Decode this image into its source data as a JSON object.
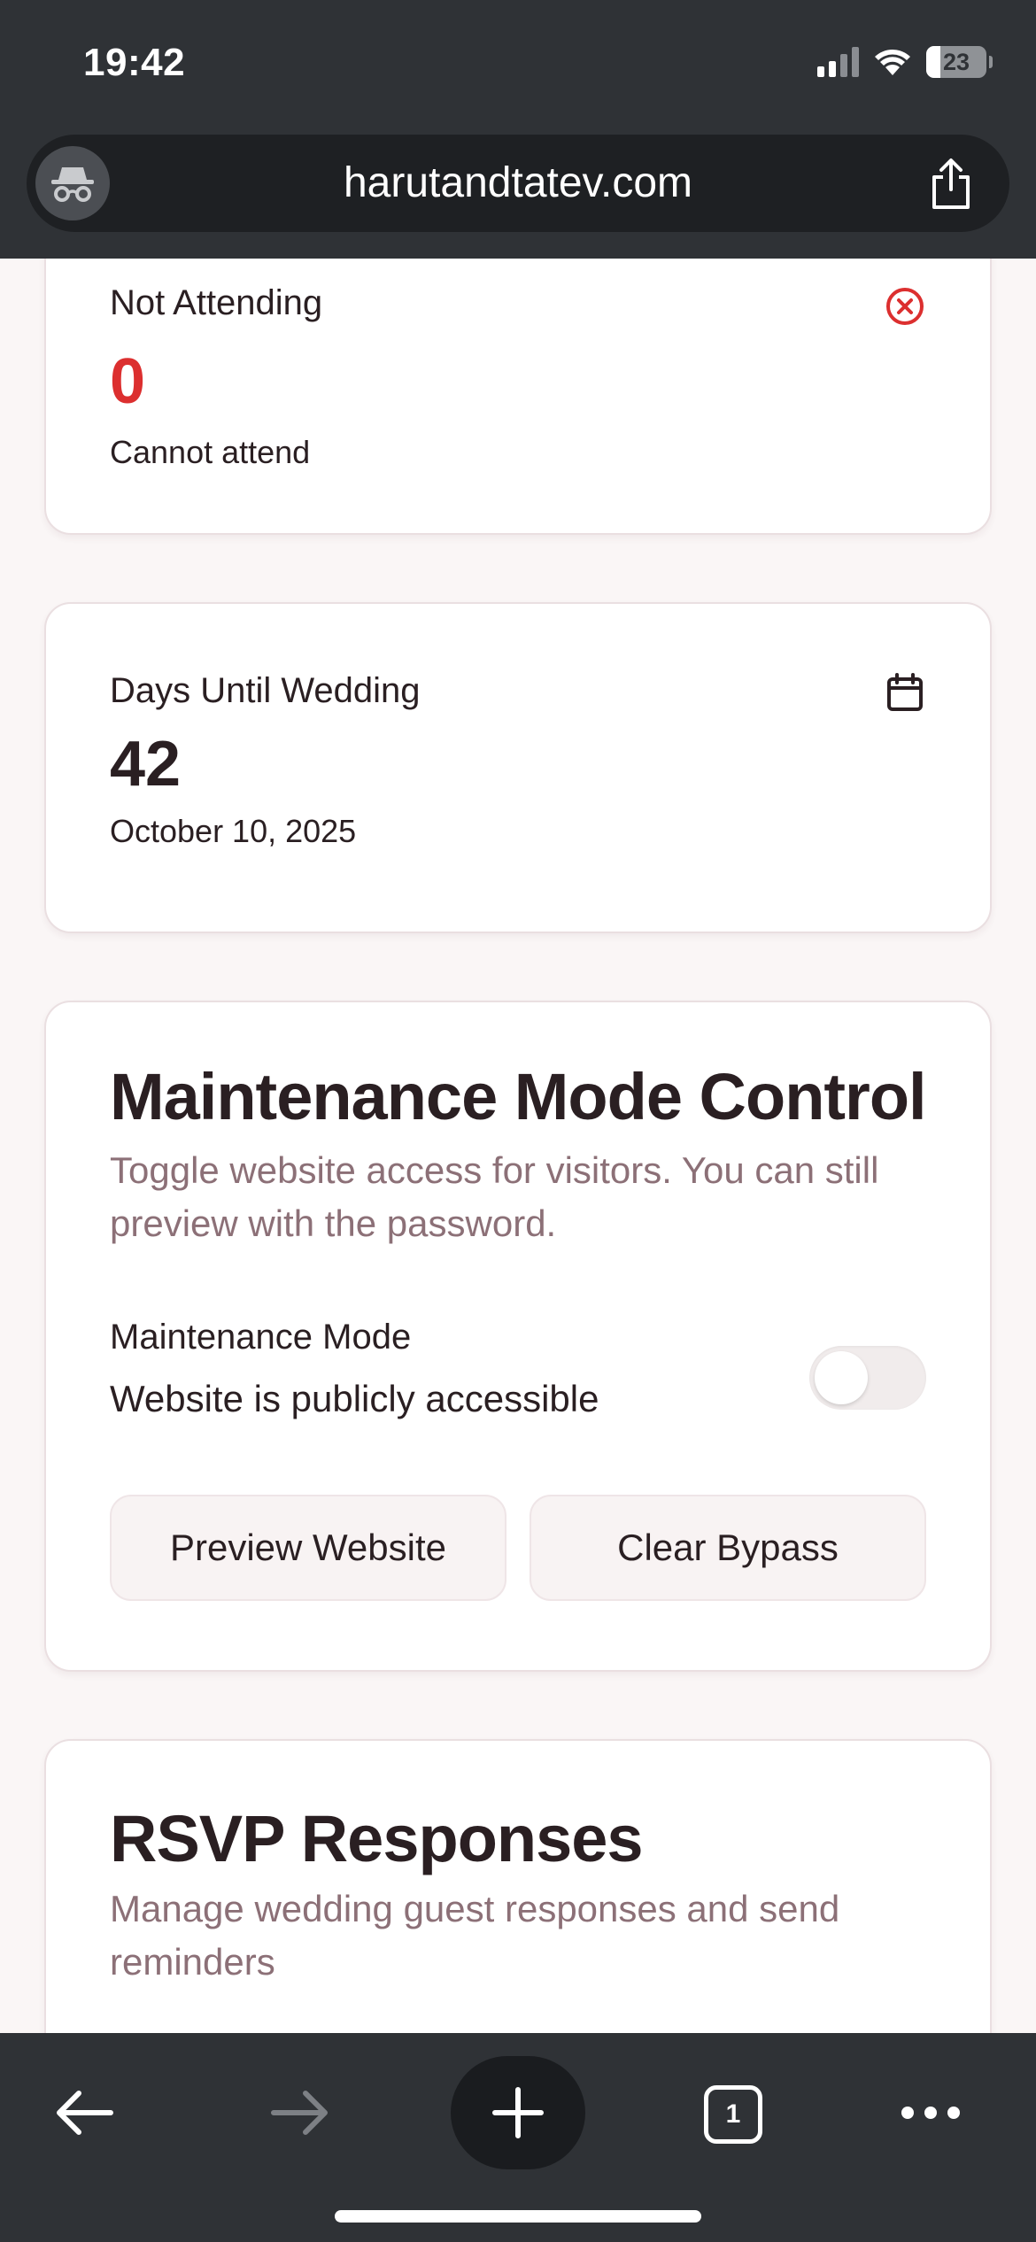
{
  "status_bar": {
    "time": "19:42",
    "battery": "23",
    "icons": [
      "cellular-signal-icon",
      "wifi-icon",
      "battery-icon"
    ]
  },
  "browser": {
    "url": "harutandtatev.com",
    "left_icon": "incognito-icon",
    "right_icon": "share-icon"
  },
  "cards": {
    "not_attending": {
      "title": "Not Attending",
      "value": "0",
      "subtitle": "Cannot attend",
      "icon": "x-circle-icon",
      "accent": "#dc2f2f"
    },
    "days_until": {
      "title": "Days Until Wedding",
      "value": "42",
      "subtitle": "October 10, 2025",
      "icon": "calendar-icon"
    },
    "maintenance": {
      "title": "Maintenance Mode Control",
      "description": "Toggle website access for visitors. You can still preview with the password.",
      "setting_label": "Maintenance Mode",
      "setting_status": "Website is publicly accessible",
      "toggle_on": false,
      "preview_button": "Preview Website",
      "clear_button": "Clear Bypass"
    },
    "rsvp": {
      "title": "RSVP Responses",
      "description": "Manage wedding guest responses and send reminders"
    }
  },
  "toolbar": {
    "tabs_count": "1",
    "icons": [
      "back-arrow-icon",
      "forward-arrow-icon",
      "plus-icon",
      "tabs-icon",
      "more-icon"
    ]
  },
  "colors": {
    "chrome": "#2f3236",
    "page_bg": "#faf6f6",
    "muted_text": "#8c7077",
    "danger": "#dc2f2f"
  }
}
